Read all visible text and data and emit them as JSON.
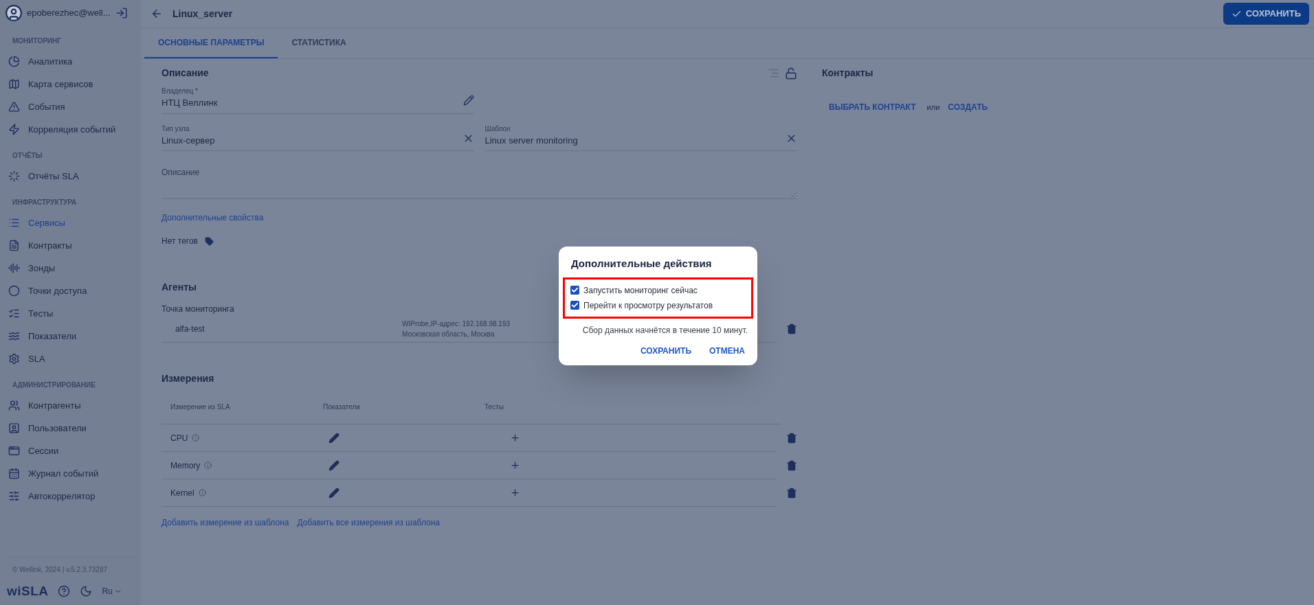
{
  "sidebar": {
    "user": "epoberezhec@well...",
    "sections": [
      {
        "title": "МОНИТОРИНГ",
        "items": [
          {
            "label": "Аналитика",
            "selected": false
          },
          {
            "label": "Карта сервисов",
            "selected": false
          },
          {
            "label": "События",
            "selected": false
          },
          {
            "label": "Корреляция событий",
            "selected": false
          }
        ]
      },
      {
        "title": "ОТЧЁТЫ",
        "items": [
          {
            "label": "Отчёты SLA",
            "selected": false
          }
        ]
      },
      {
        "title": "ИНФРАСТРУКТУРА",
        "items": [
          {
            "label": "Сервисы",
            "selected": true
          },
          {
            "label": "Контракты",
            "selected": false
          },
          {
            "label": "Зонды",
            "selected": false
          },
          {
            "label": "Точки доступа",
            "selected": false
          },
          {
            "label": "Тесты",
            "selected": false
          },
          {
            "label": "Показатели",
            "selected": false
          },
          {
            "label": "SLA",
            "selected": false
          }
        ]
      },
      {
        "title": "АДМИНИСТРИРОВАНИЕ",
        "items": [
          {
            "label": "Контрагенты",
            "selected": false
          },
          {
            "label": "Пользователи",
            "selected": false
          },
          {
            "label": "Сессии",
            "selected": false
          },
          {
            "label": "Журнал событий",
            "selected": false
          },
          {
            "label": "Автокоррелятор",
            "selected": false
          }
        ]
      }
    ],
    "copyright": "© Wellink, 2024 | v.5.2.3.73287",
    "logo": "wiSLA",
    "language": "Ru"
  },
  "header": {
    "title": "Linux_server",
    "save_button": "СОХРАНИТЬ"
  },
  "tabs": [
    {
      "label": "ОСНОВНЫЕ ПАРАМЕТРЫ",
      "selected": true
    },
    {
      "label": "СТАТИСТИКА",
      "selected": false
    }
  ],
  "description": {
    "title": "Описание",
    "owner": {
      "label": "Владелец *",
      "value": "НТЦ Веллинк"
    },
    "fields": [
      {
        "label": "Тип узла",
        "value": "Linux-сервер"
      },
      {
        "label": "Шаблон",
        "value": "Linux server monitoring"
      }
    ],
    "text_field": {
      "placeholder": "Описание"
    },
    "extra_link": "Дополнительные свойства",
    "tags": "Нет тегов"
  },
  "agents": {
    "title": "Агенты",
    "subtitle": "Точка мониторинга",
    "rows": [
      {
        "name": "alfa-test",
        "details": [
          "WIProbe,IP-адрес: 192.168.98.193",
          "Московская область, Москва"
        ]
      }
    ]
  },
  "measurements": {
    "title": "Измерения",
    "columns": [
      "Измерение из SLA",
      "Показатели",
      "Тесты"
    ],
    "rows": [
      {
        "name": "CPU"
      },
      {
        "name": "Memory"
      },
      {
        "name": "Kernel"
      }
    ],
    "links": [
      "Добавить измерение из шаблона",
      "Добавить все измерения из шаблона"
    ]
  },
  "contracts": {
    "title": "Контракты",
    "choose": "ВЫБРАТЬ КОНТРАКТ",
    "or": "или",
    "create": "СОЗДАТЬ"
  },
  "dialog": {
    "title": "Дополнительные действия",
    "highlighted": true,
    "options": [
      {
        "label": "Запустить мониторинг сейчас",
        "checked": true
      },
      {
        "label": "Перейти к просмотру результатов",
        "checked": true
      }
    ],
    "note": "Сбор данных начнётся в течение 10 минут.",
    "buttons": [
      "СОХРАНИТЬ",
      "ОТМЕНА"
    ]
  }
}
